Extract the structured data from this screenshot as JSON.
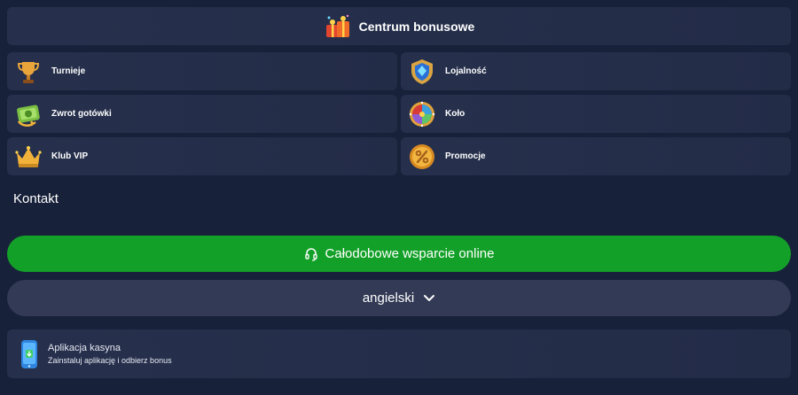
{
  "bonus_center": {
    "title": "Centrum bonusowe",
    "icon": "gift-boxes-icon"
  },
  "tiles": [
    {
      "label": "Turnieje",
      "icon": "trophy-icon"
    },
    {
      "label": "Lojalność",
      "icon": "shield-diamond-icon"
    },
    {
      "label": "Zwrot gotówki",
      "icon": "cashback-icon"
    },
    {
      "label": "Koło",
      "icon": "wheel-icon"
    },
    {
      "label": "Klub VIP",
      "icon": "crown-icon"
    },
    {
      "label": "Promocje",
      "icon": "percent-coin-icon"
    }
  ],
  "contact": {
    "heading": "Kontakt"
  },
  "support": {
    "label": "Całodobowe wsparcie online",
    "icon": "headset-icon",
    "color": "#13a028"
  },
  "language": {
    "label": "angielski",
    "icon": "chevron-down-icon"
  },
  "app": {
    "title": "Aplikacja kasyna",
    "subtitle": "Zainstaluj aplikację i odbierz bonus",
    "icon": "phone-app-icon"
  },
  "colors": {
    "background": "#18213a",
    "card": "#26304c",
    "support_green": "#13a028",
    "language_bg": "#323a55"
  }
}
